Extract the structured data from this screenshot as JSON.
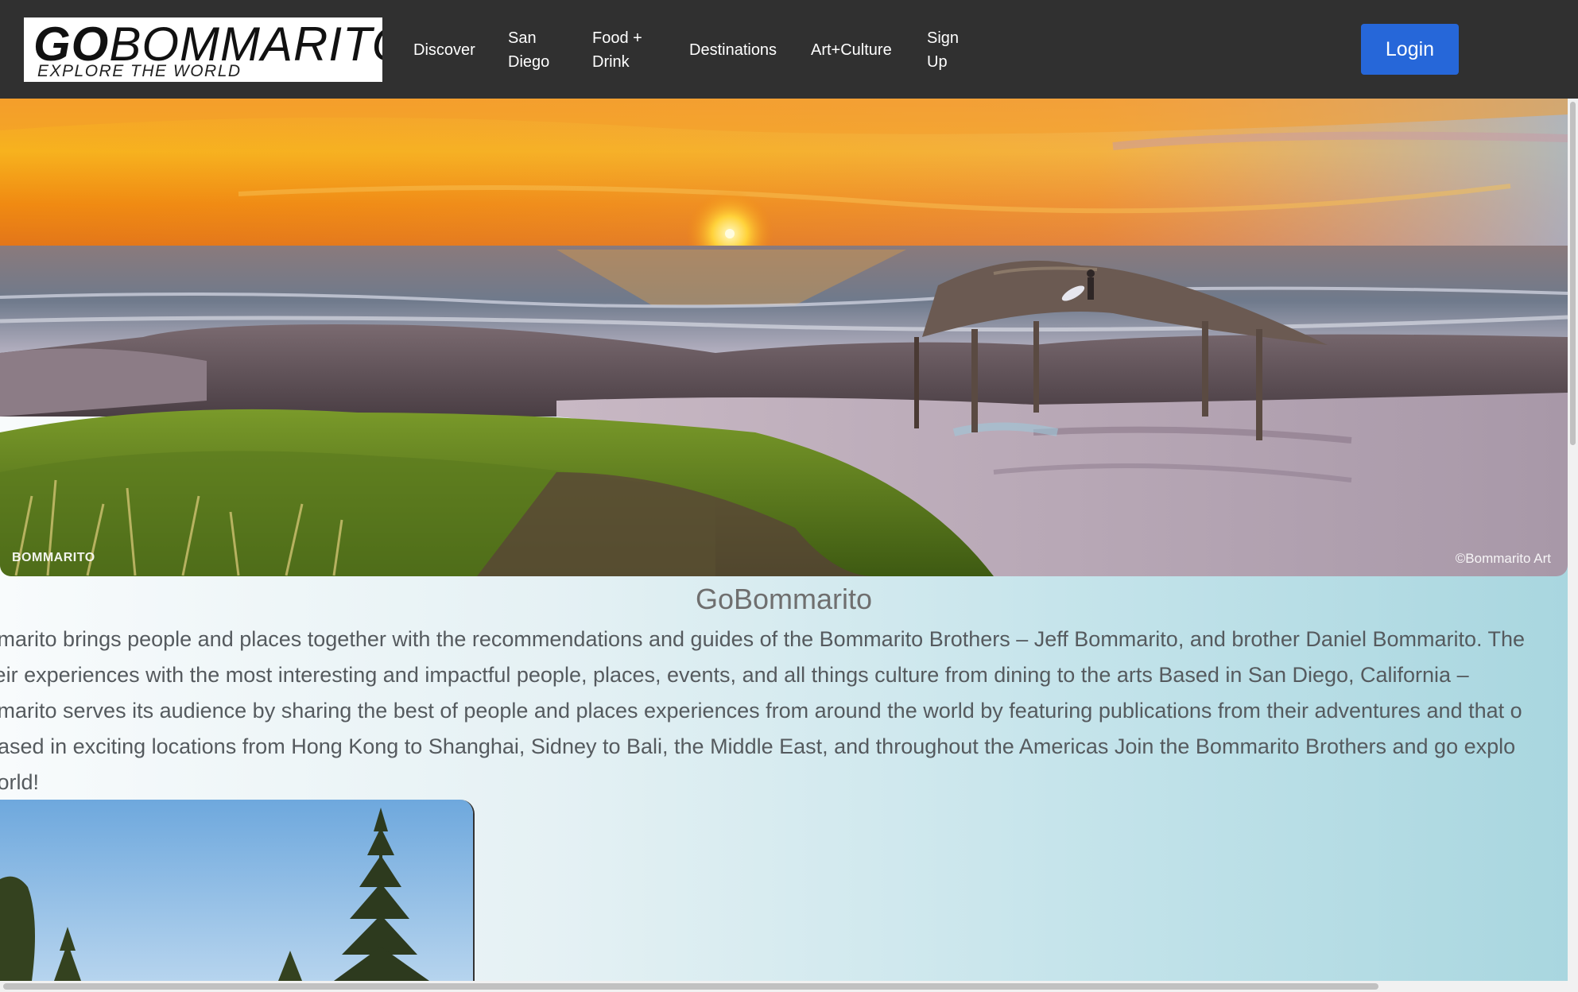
{
  "nav": {
    "logo": {
      "go": "GO",
      "rest": "BOMMARITO",
      "tagline": "EXPLORE THE WORLD"
    },
    "links": [
      {
        "line1": "Discover",
        "line2": ""
      },
      {
        "line1": "San",
        "line2": "Diego"
      },
      {
        "line1": "Food +",
        "line2": "Drink"
      },
      {
        "line1": "Destinations",
        "line2": ""
      },
      {
        "line1": "Art+Culture",
        "line2": ""
      },
      {
        "line1": "Sign",
        "line2": "Up"
      }
    ],
    "login_label": "Login"
  },
  "hero": {
    "watermark_left": "BOMMARITO",
    "watermark_right": "©Bommarito Art"
  },
  "main": {
    "title": "GoBommarito",
    "intro_lines": [
      "GoBommarito brings people and places together with the recommendations and guides of the Bommarito Brothers – Jeff Bommarito, and brother Daniel Bommarito. The",
      "share their experiences with the most interesting and impactful people, places, events, and all things culture from dining to the arts Based in San Diego, California –",
      "GoBommarito serves its audience by sharing the best of people and places experiences from around the world by featuring publications from their adventures and that o",
      "writers based in exciting locations from Hong Kong to Shanghai, Sidney to Bali, the Middle East, and throughout the Americas Join the Bommarito Brothers and go explo",
      "the world!"
    ]
  },
  "colors": {
    "navbar": "#303030",
    "login_button": "#2667d9",
    "title_text": "#6f6f6f",
    "body_text": "#555a5e"
  }
}
